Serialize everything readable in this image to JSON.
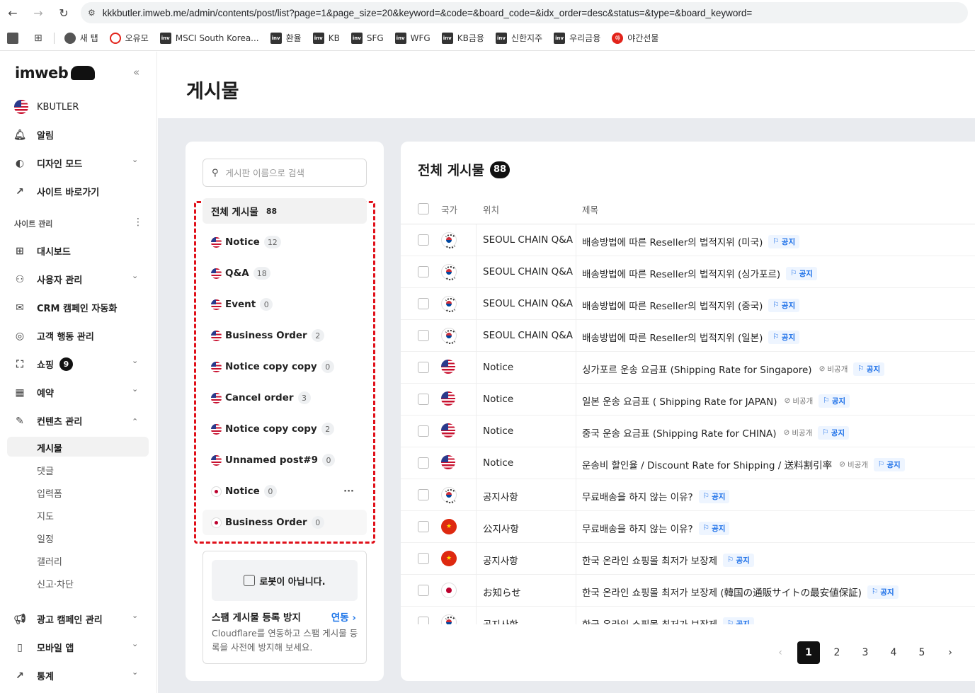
{
  "browser": {
    "url": "kkkbutler.imweb.me/admin/contents/post/list?page=1&page_size=20&keyword=&code=&board_code=&idx_order=desc&status=&type=&board_keyword=",
    "bookmarks": [
      "새 탭",
      "오유모",
      "MSCI South Korea...",
      "환율",
      "KB",
      "SFG",
      "WFG",
      "KB금융",
      "신한지주",
      "우리금융",
      "야간선물"
    ],
    "bm_icon_text": "inv",
    "bm_red_text": "야"
  },
  "sidebar": {
    "logo": "imweb",
    "site_name": "KBUTLER",
    "top_items": [
      {
        "label": "알림"
      },
      {
        "label": "디자인 모드"
      },
      {
        "label": "사이트 바로가기"
      }
    ],
    "section_label": "사이트 관리",
    "items": [
      {
        "label": "대시보드"
      },
      {
        "label": "사용자 관리"
      },
      {
        "label": "CRM 캠페인 자동화"
      },
      {
        "label": "고객 행동 관리"
      },
      {
        "label": "쇼핑",
        "badge": "9"
      },
      {
        "label": "예약"
      },
      {
        "label": "컨텐츠 관리"
      }
    ],
    "sub_items": [
      "게시물",
      "댓글",
      "입력폼",
      "지도",
      "일정",
      "갤러리",
      "신고·차단"
    ],
    "bottom_items": [
      {
        "label": "광고 캠페인 관리"
      },
      {
        "label": "모바일 앱"
      },
      {
        "label": "통계"
      }
    ]
  },
  "page": {
    "title": "게시물"
  },
  "boards": {
    "search_placeholder": "게시판 이름으로 검색",
    "all": {
      "label": "전체 게시물",
      "count": "88"
    },
    "items": [
      {
        "label": "Notice",
        "count": "12",
        "flag": "us"
      },
      {
        "label": "Q&A",
        "count": "18",
        "flag": "us"
      },
      {
        "label": "Event",
        "count": "0",
        "flag": "us"
      },
      {
        "label": "Business Order",
        "count": "2",
        "flag": "us"
      },
      {
        "label": "Notice copy copy",
        "count": "0",
        "flag": "us"
      },
      {
        "label": "Cancel order",
        "count": "3",
        "flag": "us"
      },
      {
        "label": "Notice copy copy",
        "count": "2",
        "flag": "us"
      },
      {
        "label": "Unnamed post#9",
        "count": "0",
        "flag": "us"
      },
      {
        "label": "Notice",
        "count": "0",
        "flag": "jp"
      },
      {
        "label": "Business Order",
        "count": "0",
        "flag": "jp"
      }
    ],
    "more": "···"
  },
  "spam": {
    "captcha": "로봇이 아닙니다.",
    "title": "스팸 게시물 등록 방지",
    "link": "연동",
    "desc": "Cloudflare를 연동하고 스팸 게시물 등록을 사전에 방지해 보세요."
  },
  "posts": {
    "title": "전체 게시물",
    "count": "88",
    "columns": {
      "country": "국가",
      "location": "위치",
      "title": "제목"
    },
    "notice_tag": "공지",
    "private_tag": "비공개",
    "cn_star": "★",
    "rows": [
      {
        "flag": "kr",
        "location": "SEOUL CHAIN Q&A",
        "title": "배송방법에 따른 Reseller의 법적지위 (미국)",
        "private": false
      },
      {
        "flag": "kr",
        "location": "SEOUL CHAIN Q&A",
        "title": "배송방법에 따른 Reseller의 법적지위 (싱가포르)",
        "private": false
      },
      {
        "flag": "kr",
        "location": "SEOUL CHAIN Q&A",
        "title": "배송방법에 따른 Reseller의 법적지위 (중국)",
        "private": false
      },
      {
        "flag": "kr",
        "location": "SEOUL CHAIN Q&A",
        "title": "배송방법에 따른 Reseller의 법적지위 (일본)",
        "private": false
      },
      {
        "flag": "us",
        "location": "Notice",
        "title": "싱가포르 운송 요금표 (Shipping Rate for Singapore)",
        "private": true
      },
      {
        "flag": "us",
        "location": "Notice",
        "title": "일본 운송 요금표 ( Shipping Rate for JAPAN)",
        "private": true
      },
      {
        "flag": "us",
        "location": "Notice",
        "title": "중국 운송 요금표 (Shipping Rate for CHINA)",
        "private": true
      },
      {
        "flag": "us",
        "location": "Notice",
        "title": "운송비 할인율 / Discount Rate for Shipping / 送料割引率",
        "private": true
      },
      {
        "flag": "kr",
        "location": "공지사항",
        "title": "무료배송을 하지 않는 이유?",
        "private": false
      },
      {
        "flag": "cn",
        "location": "公지사항",
        "title": "무료배송을 하지 않는 이유?",
        "private": false
      },
      {
        "flag": "cn",
        "location": "공지사항",
        "title": "한국 온라인 쇼핑몰 최저가 보장제",
        "private": false
      },
      {
        "flag": "jp",
        "location": "お知らせ",
        "title": "한국 온라인 쇼핑몰 최저가 보장제 (韓国の通販サイトの最安値保証)",
        "private": false
      },
      {
        "flag": "kr",
        "location": "공지사항",
        "title": "한국 온라인 쇼핑몰 최저가 보장제",
        "private": false
      }
    ]
  },
  "pagination": {
    "pages": [
      "1",
      "2",
      "3",
      "4",
      "5"
    ],
    "current": "1",
    "prev": "‹",
    "next": "›"
  }
}
